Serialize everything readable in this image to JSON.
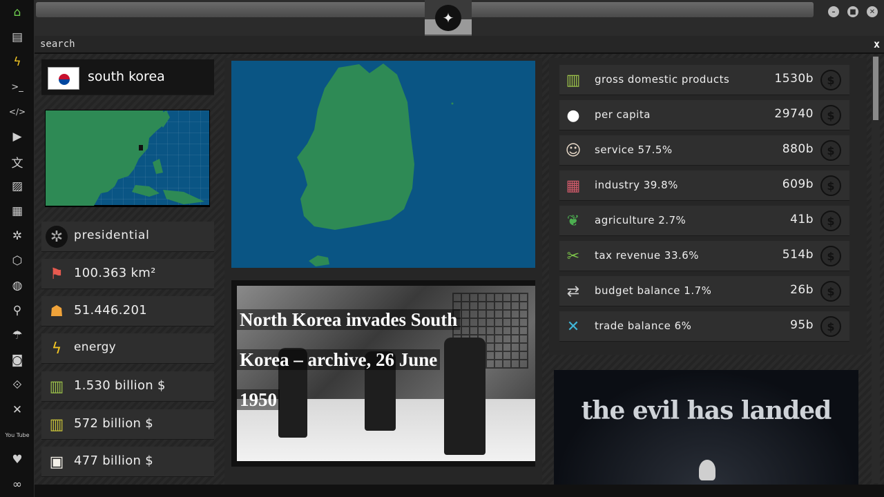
{
  "sidebar": {
    "items": [
      {
        "icon": "home-icon",
        "glyph": "⌂"
      },
      {
        "icon": "document-icon",
        "glyph": "▤"
      },
      {
        "icon": "lightning-icon",
        "glyph": "ϟ"
      },
      {
        "icon": "terminal-icon",
        "glyph": ">_"
      },
      {
        "icon": "code-icon",
        "glyph": "</>"
      },
      {
        "icon": "play-icon",
        "glyph": "▶"
      },
      {
        "icon": "translate-icon",
        "glyph": "文"
      },
      {
        "icon": "image-icon",
        "glyph": "▨"
      },
      {
        "icon": "news-icon",
        "glyph": "▦"
      },
      {
        "icon": "empire-icon",
        "glyph": "✲"
      },
      {
        "icon": "hexagon-icon",
        "glyph": "⬡"
      },
      {
        "icon": "globe-icon",
        "glyph": "◍"
      },
      {
        "icon": "search-icon",
        "glyph": "⚲"
      },
      {
        "icon": "umbrella-icon",
        "glyph": "☂"
      },
      {
        "icon": "contact-icon",
        "glyph": "◙"
      },
      {
        "icon": "link-icon",
        "glyph": "⟐"
      },
      {
        "icon": "expand-icon",
        "glyph": "✕"
      },
      {
        "icon": "youtube-icon",
        "glyph": "You Tube"
      },
      {
        "icon": "heart-icon",
        "glyph": "♥"
      },
      {
        "icon": "infinity-icon",
        "glyph": "∞"
      }
    ]
  },
  "search": {
    "label": "search",
    "close": "x"
  },
  "country": {
    "name": "south korea"
  },
  "facts": [
    {
      "icon": "empire-icon",
      "glyph": "✲",
      "text": "presidential"
    },
    {
      "icon": "map-pin-icon",
      "glyph": "⚑",
      "text": "100.363 km²"
    },
    {
      "icon": "population-icon",
      "glyph": "☗",
      "text": "51.446.201"
    },
    {
      "icon": "energy-icon",
      "glyph": "ϟ",
      "text": "energy"
    },
    {
      "icon": "money-stack-icon",
      "glyph": "▥",
      "text": "1.530 billion $"
    },
    {
      "icon": "money-truck-icon",
      "glyph": "▥",
      "text": "572 billion $"
    },
    {
      "icon": "package-icon",
      "glyph": "▣",
      "text": "477 billion $"
    }
  ],
  "news": {
    "lines": [
      "North Korea invades South",
      "Korea – archive, 26 June",
      "1950"
    ]
  },
  "economy": [
    {
      "icon": "money-stack-icon",
      "glyph": "▥",
      "label": "gross domestic products",
      "value": "1530b"
    },
    {
      "icon": "person-icon",
      "glyph": "●",
      "label": "per capita",
      "value": "29740"
    },
    {
      "icon": "chef-icon",
      "glyph": "☺",
      "label": "service 57.5%",
      "value": "880b"
    },
    {
      "icon": "factory-icon",
      "glyph": "▦",
      "label": "industry 39.8%",
      "value": "609b"
    },
    {
      "icon": "plant-icon",
      "glyph": "❦",
      "label": "agriculture 2.7%",
      "value": "41b"
    },
    {
      "icon": "scissors-money-icon",
      "glyph": "✂",
      "label": "tax revenue 33.6%",
      "value": "514b"
    },
    {
      "icon": "exchange-icon",
      "glyph": "⇄",
      "label": "budget balance 1.7%",
      "value": "26b"
    },
    {
      "icon": "trade-icon",
      "glyph": "✕",
      "label": "trade balance 6%",
      "value": "95b"
    }
  ],
  "coin_symbol": "$",
  "ad": {
    "text": "the evil has landed"
  },
  "colors": {
    "ocean": "#0a5584",
    "land": "#2e8a55",
    "active": "#6fcf4f"
  }
}
